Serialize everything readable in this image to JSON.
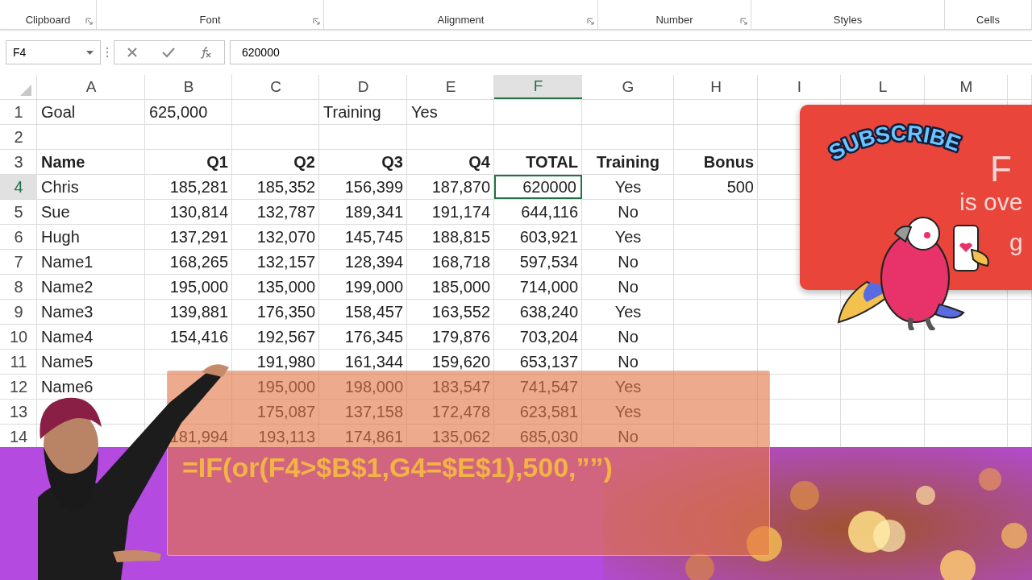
{
  "ribbon": {
    "groups": [
      {
        "label": "Clipboard",
        "launcher": true
      },
      {
        "label": "Font",
        "launcher": true
      },
      {
        "label": "Alignment",
        "launcher": true
      },
      {
        "label": "Number",
        "launcher": true
      },
      {
        "label": "Styles",
        "launcher": false
      },
      {
        "label": "Cells",
        "launcher": false
      }
    ]
  },
  "formula_bar": {
    "name_box": "F4",
    "value": "620000"
  },
  "columns": [
    {
      "label": "A",
      "selected": false
    },
    {
      "label": "B",
      "selected": false
    },
    {
      "label": "C",
      "selected": false
    },
    {
      "label": "D",
      "selected": false
    },
    {
      "label": "E",
      "selected": false
    },
    {
      "label": "F",
      "selected": true
    },
    {
      "label": "G",
      "selected": false
    },
    {
      "label": "H",
      "selected": false
    },
    {
      "label": "I",
      "selected": false
    },
    {
      "label": "L",
      "selected": false
    },
    {
      "label": "M",
      "selected": false
    }
  ],
  "rows": [
    {
      "num": "1",
      "kind": "plain",
      "selected": false,
      "cells": {
        "A": "Goal",
        "B": "625,000",
        "D": "Training",
        "E": "Yes"
      }
    },
    {
      "num": "2",
      "kind": "plain",
      "selected": false,
      "cells": {}
    },
    {
      "num": "3",
      "kind": "header",
      "selected": false,
      "cells": {
        "A": "Name",
        "B": "Q1",
        "C": "Q2",
        "D": "Q3",
        "E": "Q4",
        "F": "TOTAL",
        "G": "Training",
        "H": "Bonus"
      }
    },
    {
      "num": "4",
      "kind": "data",
      "selected": true,
      "cells": {
        "A": "Chris",
        "B": "185,281",
        "C": "185,352",
        "D": "156,399",
        "E": "187,870",
        "F": "620000",
        "G": "Yes",
        "H": "500"
      }
    },
    {
      "num": "5",
      "kind": "data",
      "selected": false,
      "cells": {
        "A": "Sue",
        "B": "130,814",
        "C": "132,787",
        "D": "189,341",
        "E": "191,174",
        "F": "644,116",
        "G": "No"
      }
    },
    {
      "num": "6",
      "kind": "data",
      "selected": false,
      "cells": {
        "A": "Hugh",
        "B": "137,291",
        "C": "132,070",
        "D": "145,745",
        "E": "188,815",
        "F": "603,921",
        "G": "Yes"
      }
    },
    {
      "num": "7",
      "kind": "data",
      "selected": false,
      "cells": {
        "A": "Name1",
        "B": "168,265",
        "C": "132,157",
        "D": "128,394",
        "E": "168,718",
        "F": "597,534",
        "G": "No"
      }
    },
    {
      "num": "8",
      "kind": "data",
      "selected": false,
      "cells": {
        "A": "Name2",
        "B": "195,000",
        "C": "135,000",
        "D": "199,000",
        "E": "185,000",
        "F": "714,000",
        "G": "No"
      }
    },
    {
      "num": "9",
      "kind": "data",
      "selected": false,
      "cells": {
        "A": "Name3",
        "B": "139,881",
        "C": "176,350",
        "D": "158,457",
        "E": "163,552",
        "F": "638,240",
        "G": "Yes"
      }
    },
    {
      "num": "10",
      "kind": "data",
      "selected": false,
      "cells": {
        "A": "Name4",
        "B": "154,416",
        "C": "192,567",
        "D": "176,345",
        "E": "179,876",
        "F": "703,204",
        "G": "No"
      }
    },
    {
      "num": "11",
      "kind": "data",
      "selected": false,
      "cells": {
        "A": "Name5",
        "C": "191,980",
        "D": "161,344",
        "E": "159,620",
        "F": "653,137",
        "G": "No"
      }
    },
    {
      "num": "12",
      "kind": "data",
      "selected": false,
      "cells": {
        "A": "Name6",
        "C": "195,000",
        "D": "198,000",
        "E": "183,547",
        "F": "741,547",
        "G": "Yes"
      }
    },
    {
      "num": "13",
      "kind": "data",
      "selected": false,
      "cells": {
        "C": "175,087",
        "D": "137,158",
        "E": "172,478",
        "F": "623,581",
        "G": "Yes"
      }
    },
    {
      "num": "14",
      "kind": "data",
      "selected": false,
      "cells": {
        "B": "181,994",
        "C": "193,113",
        "D": "174,861",
        "E": "135,062",
        "F": "685,030",
        "G": "No"
      }
    }
  ],
  "caption": {
    "formula": "=IF(or(F4>$B$1,G4=$E$1),500,””)"
  },
  "subscribe_card": {
    "badge": "SUBSCRIBE",
    "texts": [
      "F",
      "is ove",
      "g"
    ]
  }
}
